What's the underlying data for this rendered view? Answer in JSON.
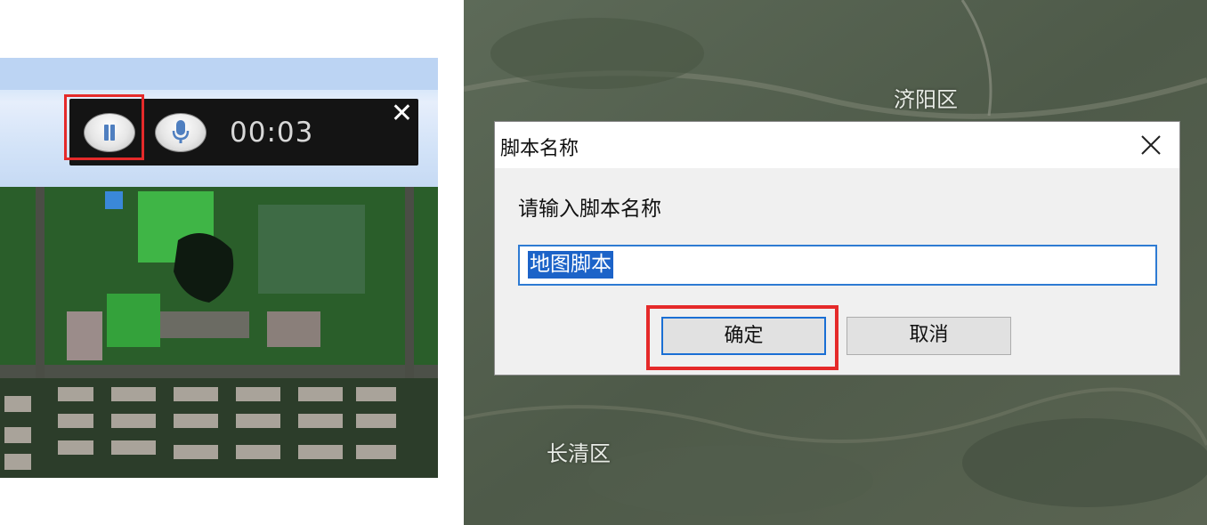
{
  "recorder": {
    "time": "00:03",
    "pause_icon": "pause-icon",
    "mic_icon": "microphone-icon",
    "close_glyph": "✕"
  },
  "map_labels": {
    "jiyang": "济阳区",
    "changqing": "长清区"
  },
  "dialog": {
    "title": "脚本名称",
    "prompt": "请输入脚本名称",
    "input_value": "地图脚本",
    "ok_label": "确定",
    "cancel_label": "取消"
  },
  "colors": {
    "highlight": "#e52a2a",
    "focus_blue": "#1a6fd4",
    "selection": "#1c63c8",
    "toolbar_bg": "#141414"
  }
}
